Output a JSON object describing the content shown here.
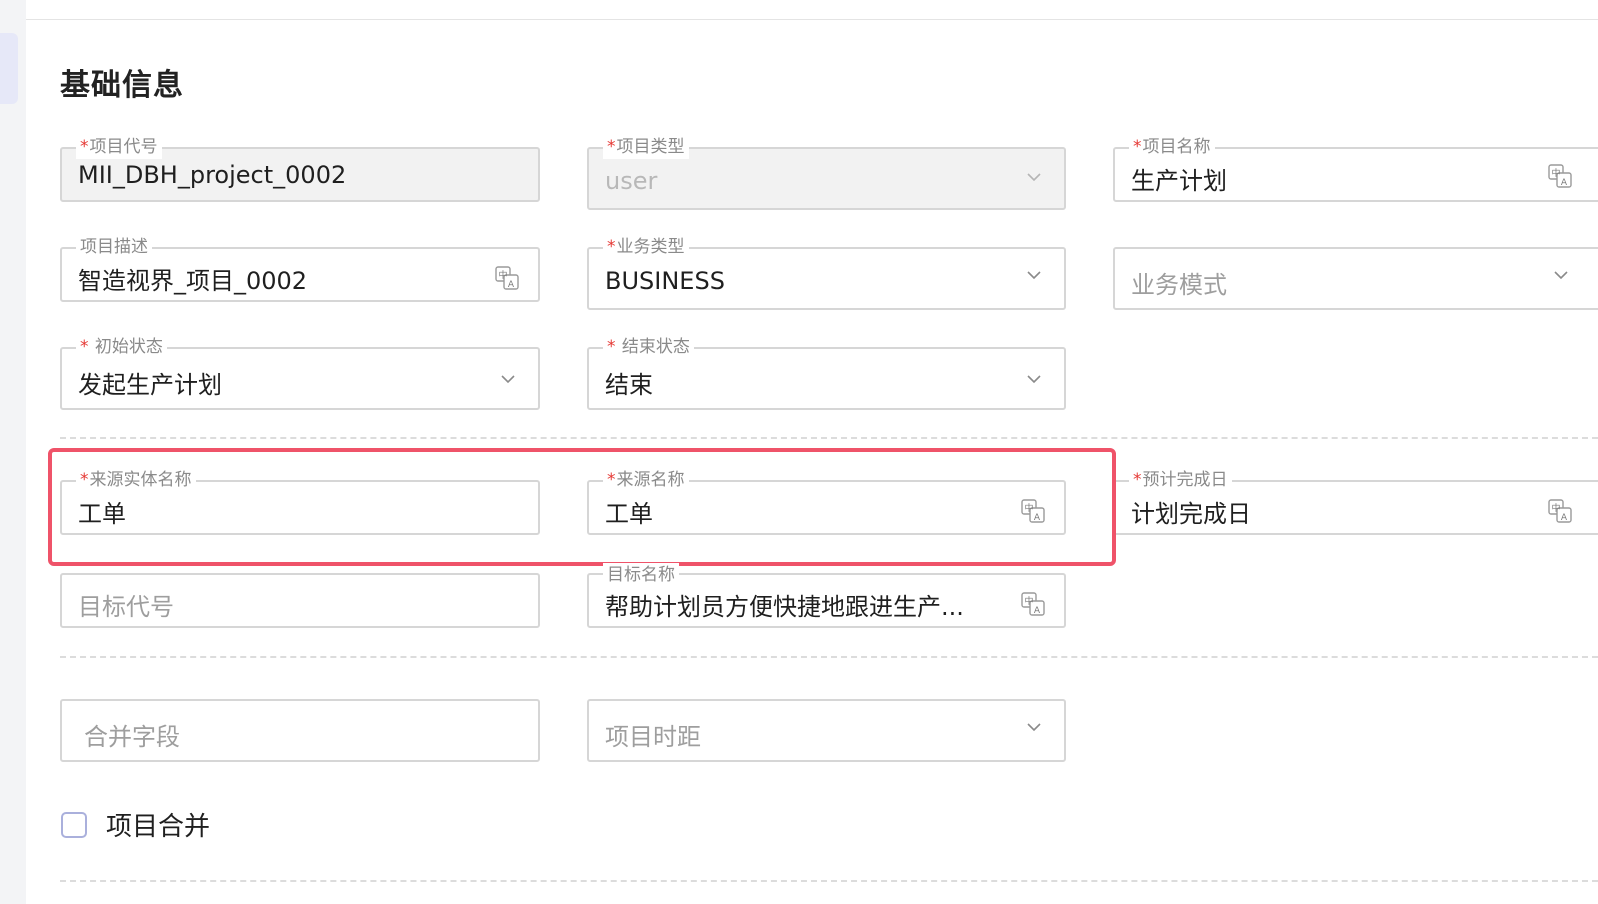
{
  "section": {
    "title": "基础信息"
  },
  "fields": {
    "project_code": {
      "required": "*",
      "label": "项目代号",
      "value": "MII_DBH_project_0002"
    },
    "project_type": {
      "required": "*",
      "label": "项目类型",
      "value": "user"
    },
    "project_name": {
      "required": "*",
      "label": "项目名称",
      "value": "生产计划"
    },
    "project_desc": {
      "label": "项目描述",
      "value": "智造视界_项目_0002"
    },
    "business_type": {
      "required": "*",
      "label": "业务类型",
      "value": "BUSINESS"
    },
    "business_mode": {
      "placeholder": "业务模式"
    },
    "initial_state": {
      "required": "* ",
      "label": "初始状态",
      "value": "发起生产计划"
    },
    "end_state": {
      "required": "* ",
      "label": "结束状态",
      "value": "结束"
    },
    "source_entity_name": {
      "required": "*",
      "label": "来源实体名称",
      "value": "工单"
    },
    "source_name": {
      "required": "*",
      "label": "来源名称",
      "value": "工单"
    },
    "expected_finish": {
      "required": "*",
      "label": "预计完成日",
      "value": "计划完成日"
    },
    "target_code": {
      "placeholder": "目标代号"
    },
    "target_name": {
      "label": "目标名称",
      "value": "帮助计划员方便快捷地跟进生产..."
    },
    "merge_field": {
      "placeholder": "合并字段"
    },
    "project_interval": {
      "placeholder": "项目时距"
    }
  },
  "checkbox": {
    "label": "项目合并",
    "checked": false
  },
  "icons": {
    "dropdown": "chevron-down-icon",
    "translate": "translate-icon"
  },
  "colors": {
    "highlight": "#ef5369",
    "required": "#e53935",
    "checkbox_border": "#aab0dc"
  }
}
